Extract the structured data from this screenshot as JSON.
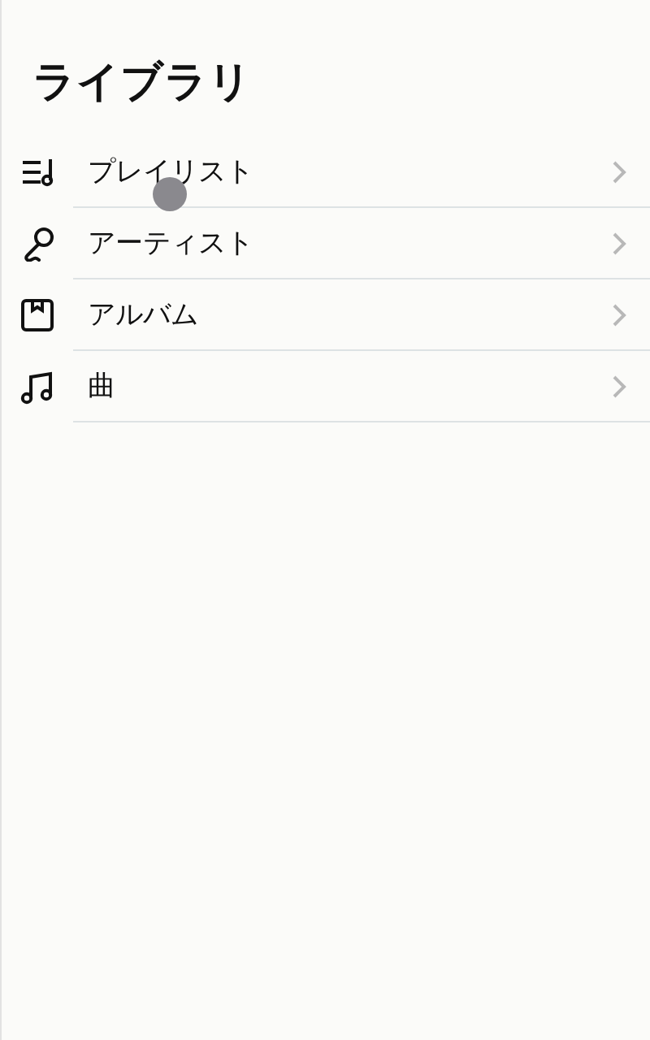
{
  "title": "ライブラリ",
  "items": [
    {
      "kind": "playlist",
      "label": "プレイリスト"
    },
    {
      "kind": "artist",
      "label": "アーティスト"
    },
    {
      "kind": "album",
      "label": "アルバム"
    },
    {
      "kind": "song",
      "label": "曲"
    }
  ],
  "touch_indicator": true
}
